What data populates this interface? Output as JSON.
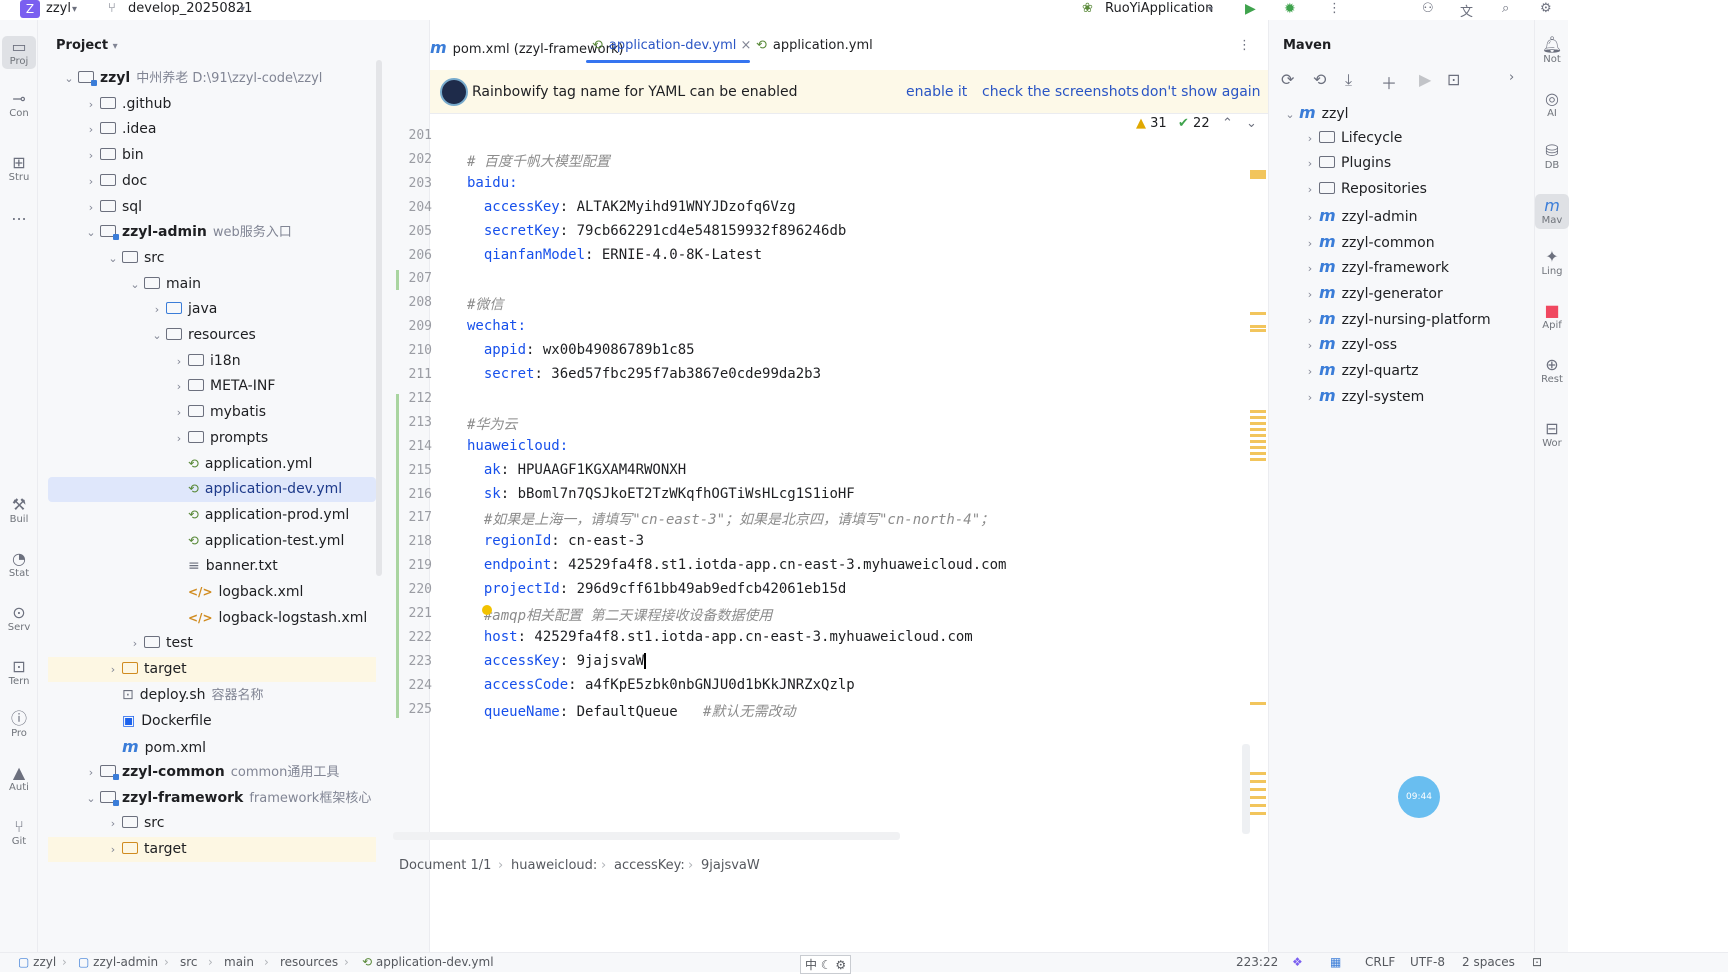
{
  "topbar": {
    "project_badge": "Z",
    "project_name": "zzyl",
    "branch": "develop_20250821",
    "run_config": "RuoYiApplication"
  },
  "left_strip": [
    {
      "label": "Proj",
      "icon": "folder-icon"
    },
    {
      "label": "Con",
      "icon": "commit-icon"
    },
    {
      "label": "Stru",
      "icon": "structure-icon"
    },
    {
      "label": "...",
      "icon": "more-icon"
    },
    {
      "label": "Buil",
      "icon": "hammer-icon"
    },
    {
      "label": "Stat",
      "icon": "statistic-icon"
    },
    {
      "label": "Serv",
      "icon": "services-icon"
    },
    {
      "label": "Tern",
      "icon": "terminal-icon"
    },
    {
      "label": "Pro",
      "icon": "problems-icon"
    },
    {
      "label": "Auti",
      "icon": "warning-icon"
    },
    {
      "label": "Git",
      "icon": "git-icon"
    }
  ],
  "project_panel": {
    "title": "Project",
    "tree": [
      {
        "depth": 0,
        "chev": "v",
        "type": "module",
        "name": "zzyl",
        "hint": "中州养老  D:\\91\\zzyl-code\\zzyl",
        "bold": true
      },
      {
        "depth": 1,
        "chev": ">",
        "type": "folder",
        "name": ".github"
      },
      {
        "depth": 1,
        "chev": ">",
        "type": "folder",
        "name": ".idea"
      },
      {
        "depth": 1,
        "chev": ">",
        "type": "folder",
        "name": "bin"
      },
      {
        "depth": 1,
        "chev": ">",
        "type": "folder",
        "name": "doc"
      },
      {
        "depth": 1,
        "chev": ">",
        "type": "folder",
        "name": "sql"
      },
      {
        "depth": 1,
        "chev": "v",
        "type": "module",
        "name": "zzyl-admin",
        "hint": "web服务入口",
        "bold": true
      },
      {
        "depth": 2,
        "chev": "v",
        "type": "folder",
        "name": "src"
      },
      {
        "depth": 3,
        "chev": "v",
        "type": "folder",
        "name": "main"
      },
      {
        "depth": 4,
        "chev": ">",
        "type": "folder-blue",
        "name": "java"
      },
      {
        "depth": 4,
        "chev": "v",
        "type": "folder",
        "name": "resources"
      },
      {
        "depth": 5,
        "chev": ">",
        "type": "folder",
        "name": "i18n"
      },
      {
        "depth": 5,
        "chev": ">",
        "type": "folder",
        "name": "META-INF"
      },
      {
        "depth": 5,
        "chev": ">",
        "type": "folder",
        "name": "mybatis"
      },
      {
        "depth": 5,
        "chev": ">",
        "type": "folder",
        "name": "prompts"
      },
      {
        "depth": 5,
        "chev": "",
        "type": "yml",
        "name": "application.yml"
      },
      {
        "depth": 5,
        "chev": "",
        "type": "yml",
        "name": "application-dev.yml",
        "selected": true
      },
      {
        "depth": 5,
        "chev": "",
        "type": "yml",
        "name": "application-prod.yml"
      },
      {
        "depth": 5,
        "chev": "",
        "type": "yml",
        "name": "application-test.yml"
      },
      {
        "depth": 5,
        "chev": "",
        "type": "txt",
        "name": "banner.txt"
      },
      {
        "depth": 5,
        "chev": "",
        "type": "xml",
        "name": "logback.xml"
      },
      {
        "depth": 5,
        "chev": "",
        "type": "xml",
        "name": "logback-logstash.xml"
      },
      {
        "depth": 3,
        "chev": ">",
        "type": "folder",
        "name": "test"
      },
      {
        "depth": 2,
        "chev": ">",
        "type": "folder-orange",
        "name": "target",
        "excluded": true
      },
      {
        "depth": 2,
        "chev": "",
        "type": "sh",
        "name": "deploy.sh",
        "hint": "容器名称"
      },
      {
        "depth": 2,
        "chev": "",
        "type": "docker",
        "name": "Dockerfile"
      },
      {
        "depth": 2,
        "chev": "",
        "type": "maven",
        "name": "pom.xml"
      },
      {
        "depth": 1,
        "chev": ">",
        "type": "module",
        "name": "zzyl-common",
        "hint": "common通用工具",
        "bold": true
      },
      {
        "depth": 1,
        "chev": "v",
        "type": "module",
        "name": "zzyl-framework",
        "hint": "framework框架核心",
        "bold": true
      },
      {
        "depth": 2,
        "chev": ">",
        "type": "folder",
        "name": "src"
      },
      {
        "depth": 2,
        "chev": ">",
        "type": "folder-orange",
        "name": "target",
        "excluded": true
      }
    ]
  },
  "editor": {
    "tabs": [
      {
        "label": "pom.xml (zzyl-framework)",
        "icon": "maven-icon"
      },
      {
        "label": "application-dev.yml",
        "icon": "yaml-icon",
        "active": true,
        "closable": true
      },
      {
        "label": "application.yml",
        "icon": "yaml-icon"
      }
    ],
    "banner": {
      "text": "Rainbowify tag name for YAML can be enabled",
      "links": [
        "enable it",
        "check the screenshots",
        "don't show again"
      ]
    },
    "inspections": {
      "warnings": "31",
      "ok": "22"
    },
    "lines": [
      {
        "n": "201",
        "segs": []
      },
      {
        "n": "202",
        "segs": [
          {
            "t": "# 百度千帆大模型配置",
            "c": "c"
          }
        ]
      },
      {
        "n": "203",
        "segs": [
          {
            "t": "baidu:",
            "c": "k"
          }
        ]
      },
      {
        "n": "204",
        "segs": [
          {
            "t": "  accessKey",
            "c": "k"
          },
          {
            "t": ": ALTAK2Myihd91WNYJDzofq6Vzg",
            "c": "v"
          }
        ]
      },
      {
        "n": "205",
        "segs": [
          {
            "t": "  secretKey",
            "c": "k"
          },
          {
            "t": ": 79cb662291cd4e548159932f896246db",
            "c": "v"
          }
        ]
      },
      {
        "n": "206",
        "segs": [
          {
            "t": "  qianfanModel",
            "c": "k"
          },
          {
            "t": ": ERNIE-4.0-8K-Latest",
            "c": "v"
          }
        ]
      },
      {
        "n": "207",
        "segs": []
      },
      {
        "n": "208",
        "segs": [
          {
            "t": "#微信",
            "c": "c"
          }
        ]
      },
      {
        "n": "209",
        "segs": [
          {
            "t": "wechat:",
            "c": "k"
          }
        ]
      },
      {
        "n": "210",
        "segs": [
          {
            "t": "  appid",
            "c": "k"
          },
          {
            "t": ": wx00b49086789b1c85",
            "c": "v"
          }
        ]
      },
      {
        "n": "211",
        "segs": [
          {
            "t": "  secret",
            "c": "k"
          },
          {
            "t": ": 36ed57fbc295f7ab3867e0cde99da2b3",
            "c": "v"
          }
        ]
      },
      {
        "n": "212",
        "segs": []
      },
      {
        "n": "213",
        "segs": [
          {
            "t": "#华为云",
            "c": "c"
          }
        ]
      },
      {
        "n": "214",
        "segs": [
          {
            "t": "huaweicloud:",
            "c": "k"
          }
        ]
      },
      {
        "n": "215",
        "segs": [
          {
            "t": "  ak",
            "c": "k"
          },
          {
            "t": ": HPUAAGF1KGXAM4RWONXH",
            "c": "v"
          }
        ]
      },
      {
        "n": "216",
        "segs": [
          {
            "t": "  sk",
            "c": "k"
          },
          {
            "t": ": bBoml7n7QSJkoET2TzWKqfhOGTiWsHLcg1S1ioHF",
            "c": "v"
          }
        ]
      },
      {
        "n": "217",
        "segs": [
          {
            "t": "  #如果是上海一，请填写\"cn-east-3\"；如果是北京四，请填写\"cn-north-4\"；",
            "c": "c"
          }
        ]
      },
      {
        "n": "218",
        "segs": [
          {
            "t": "  regionId",
            "c": "k"
          },
          {
            "t": ": cn-east-3",
            "c": "v"
          }
        ]
      },
      {
        "n": "219",
        "segs": [
          {
            "t": "  endpoint",
            "c": "k"
          },
          {
            "t": ": 42529fa4f8.st1.iotda-app.cn-east-3.myhuaweicloud.com",
            "c": "v"
          }
        ]
      },
      {
        "n": "220",
        "segs": [
          {
            "t": "  projectId",
            "c": "k"
          },
          {
            "t": ": 296d9cff61bb49ab9edfcb42061eb15d",
            "c": "v"
          }
        ]
      },
      {
        "n": "221",
        "segs": [
          {
            "t": "  #amqp相关配置 第二天课程接收设备数据使用",
            "c": "c"
          }
        ]
      },
      {
        "n": "222",
        "segs": [
          {
            "t": "  host",
            "c": "k"
          },
          {
            "t": ": 42529fa4f8.st1.iotda-app.cn-east-3.myhuaweicloud.com",
            "c": "v"
          }
        ]
      },
      {
        "n": "223",
        "segs": [
          {
            "t": "  accessKey",
            "c": "k"
          },
          {
            "t": ": 9jajsvaW",
            "c": "v"
          }
        ]
      },
      {
        "n": "224",
        "segs": [
          {
            "t": "  accessCode",
            "c": "k"
          },
          {
            "t": ": a4fKpE5zbk0nbGNJU0d1bKkJNRZxQzlp",
            "c": "v"
          }
        ]
      },
      {
        "n": "225",
        "segs": [
          {
            "t": "  queueName",
            "c": "k"
          },
          {
            "t": ": DefaultQueue   ",
            "c": "v"
          },
          {
            "t": "#默认无需改动",
            "c": "c"
          }
        ]
      }
    ],
    "breadcrumb": [
      "Document 1/1",
      "huaweicloud:",
      "accessKey:",
      "9jajsvaW"
    ]
  },
  "maven": {
    "title": "Maven",
    "tree": [
      {
        "depth": 0,
        "chev": "v",
        "icon": "maven",
        "name": "zzyl"
      },
      {
        "depth": 1,
        "chev": ">",
        "icon": "gear-folder",
        "name": "Lifecycle"
      },
      {
        "depth": 1,
        "chev": ">",
        "icon": "gear-folder",
        "name": "Plugins"
      },
      {
        "depth": 1,
        "chev": ">",
        "icon": "folder",
        "name": "Repositories"
      },
      {
        "depth": 1,
        "chev": ">",
        "icon": "maven",
        "name": "zzyl-admin"
      },
      {
        "depth": 1,
        "chev": ">",
        "icon": "maven",
        "name": "zzyl-common"
      },
      {
        "depth": 1,
        "chev": ">",
        "icon": "maven",
        "name": "zzyl-framework"
      },
      {
        "depth": 1,
        "chev": ">",
        "icon": "maven",
        "name": "zzyl-generator"
      },
      {
        "depth": 1,
        "chev": ">",
        "icon": "maven",
        "name": "zzyl-nursing-platform"
      },
      {
        "depth": 1,
        "chev": ">",
        "icon": "maven",
        "name": "zzyl-oss"
      },
      {
        "depth": 1,
        "chev": ">",
        "icon": "maven",
        "name": "zzyl-quartz"
      },
      {
        "depth": 1,
        "chev": ">",
        "icon": "maven",
        "name": "zzyl-system"
      }
    ]
  },
  "right_strip": [
    {
      "label": "Not",
      "icon": "bell-icon"
    },
    {
      "label": "AI",
      "icon": "ai-icon"
    },
    {
      "label": "DB",
      "icon": "database-icon"
    },
    {
      "label": "Mav",
      "icon": "maven-icon"
    },
    {
      "label": "Ling",
      "icon": "lingma-icon"
    },
    {
      "label": "Apif",
      "icon": "apifox-icon"
    },
    {
      "label": "Rest",
      "icon": "globe-icon"
    },
    {
      "label": "Wor",
      "icon": "word-icon"
    }
  ],
  "status": {
    "path": [
      "zzyl",
      "zzyl-admin",
      "src",
      "main",
      "resources",
      "application-dev.yml"
    ],
    "position": "223:22",
    "line_sep": "CRLF",
    "encoding": "UTF-8",
    "indent": "2 spaces",
    "ime": "中"
  },
  "timer": "09:44"
}
